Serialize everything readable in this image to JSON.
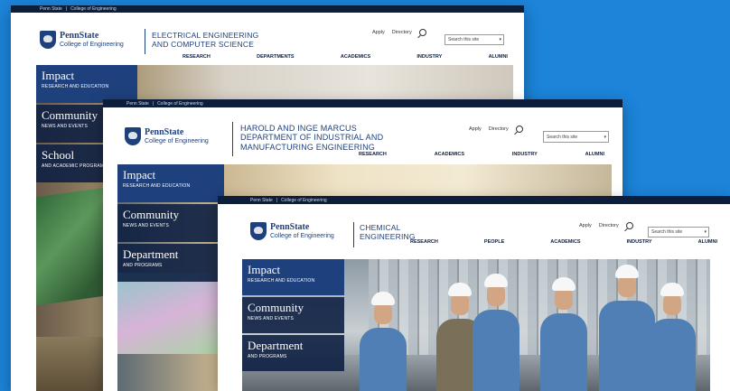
{
  "colors": {
    "background": "#1c84d9",
    "topbar": "#0d1e3d",
    "brand": "#1e407c"
  },
  "windows": [
    {
      "topbar": {
        "penn_state": "Penn State",
        "sep": "|",
        "college": "College of Engineering"
      },
      "logo": {
        "name": "PennState",
        "college": "College of Engineering"
      },
      "department_lines": [
        "Electrical Engineering",
        "and Computer Science"
      ],
      "utility": {
        "apply": "Apply",
        "directory": "Directory"
      },
      "search_placeholder": "Search this site",
      "nav": [
        "Research",
        "Departments",
        "Academics",
        "Industry",
        "Alumni"
      ],
      "sidebar": [
        {
          "title": "Impact",
          "sub": "Research and Education"
        },
        {
          "title": "Community",
          "sub": "News and Events"
        },
        {
          "title": "School",
          "sub": "and Academic Programs"
        }
      ]
    },
    {
      "topbar": {
        "penn_state": "Penn State",
        "sep": "|",
        "college": "College of Engineering"
      },
      "logo": {
        "name": "PennState",
        "college": "College of Engineering"
      },
      "department_lines": [
        "Harold and Inge Marcus",
        "Department of Industrial and",
        "Manufacturing Engineering"
      ],
      "utility": {
        "apply": "Apply",
        "directory": "Directory"
      },
      "search_placeholder": "Search this site",
      "nav": [
        "Research",
        "Academics",
        "Industry",
        "Alumni"
      ],
      "sidebar": [
        {
          "title": "Impact",
          "sub": "Research and Education"
        },
        {
          "title": "Community",
          "sub": "News and Events"
        },
        {
          "title": "Department",
          "sub": "and Programs"
        }
      ]
    },
    {
      "topbar": {
        "penn_state": "Penn State",
        "sep": "|",
        "college": "College of Engineering"
      },
      "logo": {
        "name": "PennState",
        "college": "College of Engineering"
      },
      "department_lines": [
        "Chemical",
        "Engineering"
      ],
      "utility": {
        "apply": "Apply",
        "directory": "Directory"
      },
      "search_placeholder": "Search this site",
      "nav": [
        "Research",
        "People",
        "Academics",
        "Industry",
        "Alumni"
      ],
      "sidebar": [
        {
          "title": "Impact",
          "sub": "Research and Education"
        },
        {
          "title": "Community",
          "sub": "News and Events"
        },
        {
          "title": "Department",
          "sub": "and Programs"
        }
      ]
    }
  ]
}
